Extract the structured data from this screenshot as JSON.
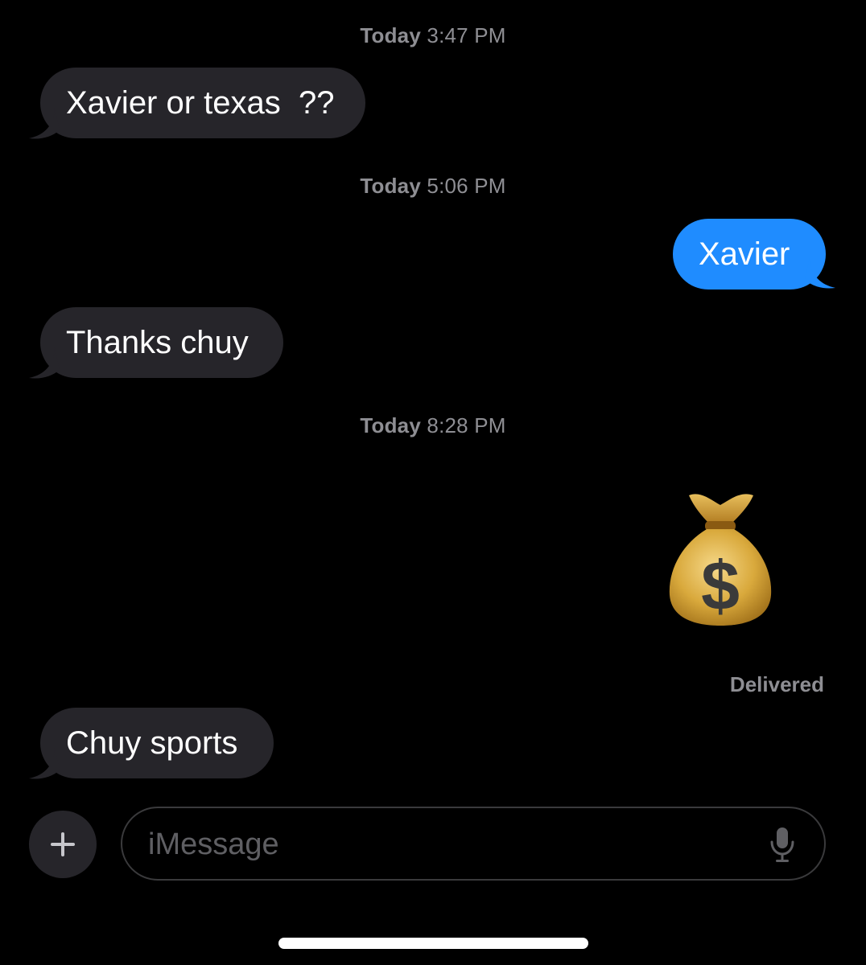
{
  "thread": {
    "timestamps": [
      {
        "day": "Today",
        "time": "3:47 PM"
      },
      {
        "day": "Today",
        "time": "5:06 PM"
      },
      {
        "day": "Today",
        "time": "8:28 PM"
      }
    ],
    "messages": [
      {
        "direction": "incoming",
        "text": "Xavier or texas  ??"
      },
      {
        "direction": "outgoing",
        "text": "Xavier"
      },
      {
        "direction": "incoming",
        "text": "Thanks chuy"
      },
      {
        "direction": "outgoing",
        "emoji": "money-bag",
        "emoji_symbol": "$"
      },
      {
        "direction": "incoming",
        "text": "Chuy sports"
      }
    ],
    "delivery_status": "Delivered"
  },
  "composer": {
    "placeholder": "iMessage",
    "plus_icon": "plus-icon",
    "mic_icon": "microphone-icon"
  },
  "colors": {
    "background": "#000000",
    "incoming_bubble": "#26252a",
    "outgoing_bubble": "#1f8cff",
    "meta_text": "#8e8e93"
  }
}
